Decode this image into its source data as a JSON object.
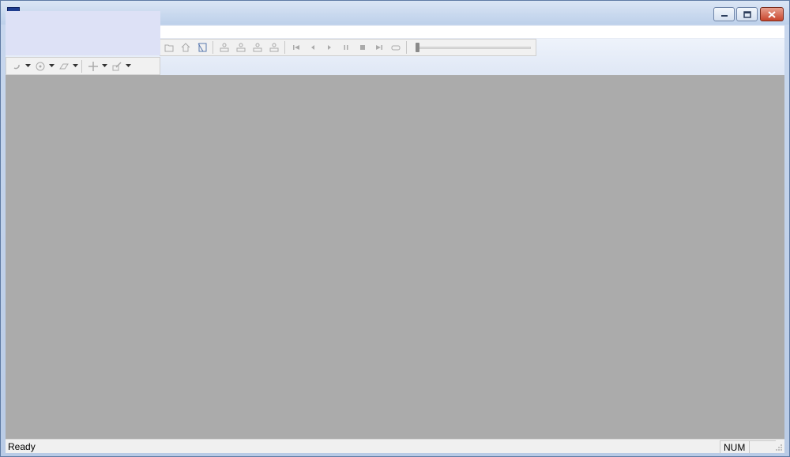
{
  "window": {
    "title": "",
    "caption_buttons": {
      "minimize_icon": "minimize-icon",
      "restore_icon": "restore-icon",
      "close_icon": "close-icon"
    }
  },
  "toolbar_main": {
    "buttons": [
      {
        "name": "open-icon"
      },
      {
        "name": "home-icon"
      },
      {
        "name": "edit-icon"
      },
      {
        "name": "person-icon-1"
      },
      {
        "name": "person-icon-2"
      },
      {
        "name": "person-icon-3"
      },
      {
        "name": "person-icon-4"
      },
      {
        "name": "first-icon"
      },
      {
        "name": "prev-icon"
      },
      {
        "name": "play-icon"
      },
      {
        "name": "pause-icon"
      },
      {
        "name": "stop-icon"
      },
      {
        "name": "last-icon"
      },
      {
        "name": "loop-icon"
      }
    ],
    "slider_value": 0
  },
  "toolbar_tools": {
    "buttons": [
      "rotate-icon",
      "disc-icon",
      "eraser-icon",
      "move-icon",
      "pen-icon"
    ]
  },
  "statusbar": {
    "text": "Ready",
    "num_indicator": "NUM"
  },
  "colors": {
    "client_background": "#ababab",
    "statusbar_background": "#f0f0f0",
    "close_button": "#c8452c"
  }
}
